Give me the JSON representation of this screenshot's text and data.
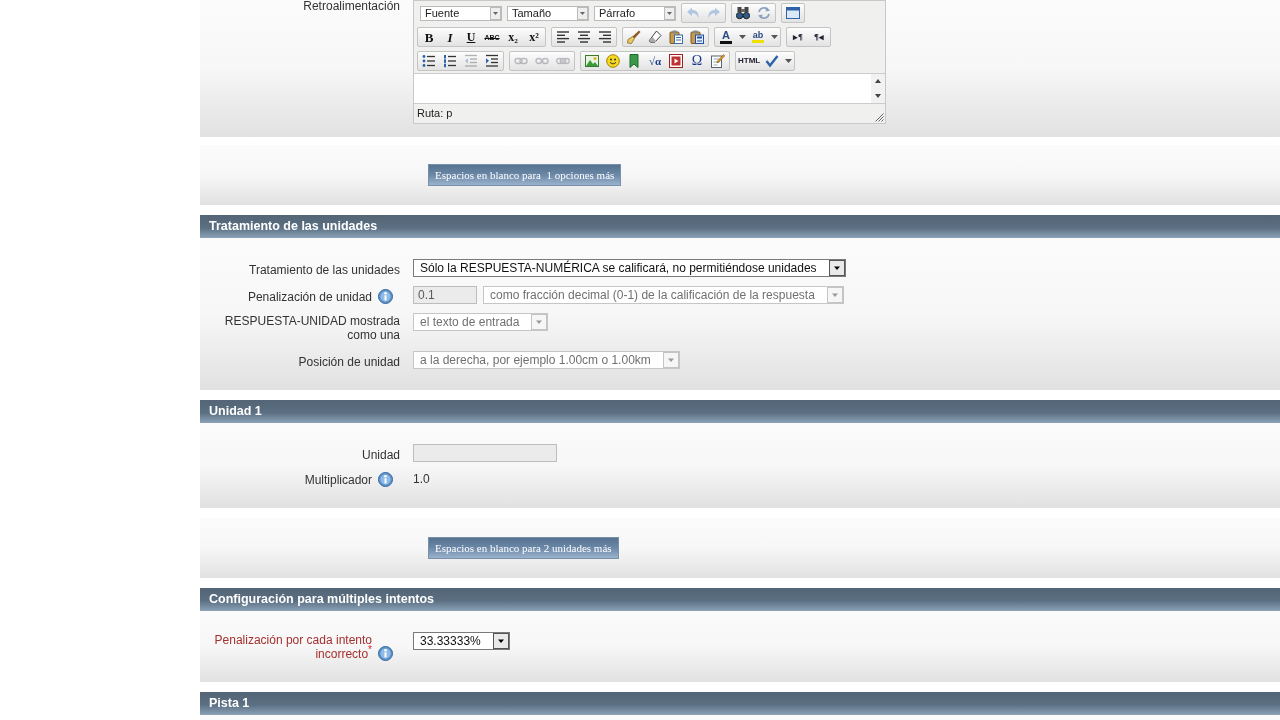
{
  "sections": [
    {
      "kind": "editor",
      "label": "Retroalimentación",
      "toolbar": [
        [
          [
            {
              "kind": "dropdown",
              "value": "Fuente",
              "disabled": false
            },
            {
              "kind": "dropdown",
              "value": "Tamaño",
              "disabled": false
            },
            {
              "kind": "dropdown",
              "value": "Párrafo",
              "disabled": false
            }
          ],
          [
            {
              "kind": "icon",
              "disabled": true
            },
            {
              "kind": "icon",
              "disabled": true
            }
          ],
          [
            {
              "kind": "icon",
              "disabled": false
            },
            {
              "kind": "icon",
              "disabled": false
            }
          ],
          [
            {
              "kind": "icon",
              "disabled": false
            }
          ]
        ],
        [
          [
            {
              "kind": "glyph",
              "glyph": "B",
              "disabled": false
            },
            {
              "kind": "glyph",
              "glyph": "I",
              "disabled": false
            },
            {
              "kind": "glyph",
              "glyph": "U",
              "disabled": false
            },
            {
              "kind": "glyph",
              "glyph": "ABC",
              "disabled": false
            },
            {
              "kind": "glyph",
              "glyph": "x₂",
              "disabled": false
            },
            {
              "kind": "glyph",
              "glyph": "x²",
              "disabled": false
            }
          ],
          [
            {
              "kind": "icon",
              "disabled": false
            },
            {
              "kind": "icon",
              "disabled": false
            },
            {
              "kind": "icon",
              "disabled": false
            }
          ],
          [
            {
              "kind": "icon",
              "disabled": false
            },
            {
              "kind": "icon",
              "disabled": false
            },
            {
              "kind": "icon",
              "disabled": false
            },
            {
              "kind": "icon",
              "disabled": false
            }
          ],
          [
            {
              "kind": "split",
              "glyph": "A",
              "disabled": false
            },
            {
              "kind": "split",
              "glyph": "ab",
              "disabled": false
            }
          ],
          [
            {
              "kind": "glyph",
              "glyph": "▸¶",
              "disabled": false
            },
            {
              "kind": "glyph",
              "glyph": "¶◂",
              "disabled": false
            }
          ]
        ],
        [
          [
            {
              "kind": "icon",
              "disabled": false
            },
            {
              "kind": "icon",
              "disabled": false
            },
            {
              "kind": "icon",
              "disabled": true
            },
            {
              "kind": "icon",
              "disabled": false
            }
          ],
          [
            {
              "kind": "icon",
              "disabled": true
            },
            {
              "kind": "icon",
              "disabled": true
            },
            {
              "kind": "icon",
              "disabled": true
            }
          ],
          [
            {
              "kind": "icon",
              "disabled": false
            },
            {
              "kind": "icon",
              "disabled": false
            },
            {
              "kind": "icon",
              "disabled": false
            },
            {
              "kind": "glyph",
              "glyph": "√α",
              "disabled": false
            },
            {
              "kind": "icon",
              "disabled": false
            },
            {
              "kind": "glyph",
              "glyph": "Ω",
              "disabled": false
            },
            {
              "kind": "icon",
              "disabled": false
            }
          ],
          [
            {
              "kind": "glyph",
              "glyph": "HTML",
              "disabled": false
            },
            {
              "kind": "split_icon",
              "disabled": false
            }
          ]
        ]
      ],
      "path": "Ruta: p"
    },
    {
      "kind": "button_panel",
      "button": "Espacios en blanco para  1 opciones más"
    },
    {
      "kind": "fieldset",
      "title": "Tratamiento de las unidades",
      "fields": [
        {
          "kind": "select",
          "label": "Tratamiento de las unidades",
          "help": false,
          "required": false,
          "value": "Sólo la RESPUESTA-NUMÉRICA se calificará, no permitiéndose unidades",
          "disabled": false
        },
        {
          "kind": "text_select",
          "label": "Penalización de unidad",
          "help": true,
          "required": false,
          "value": "0.1",
          "option": "como fracción decimal (0-1) de la calificación de la respuesta",
          "disabled": true
        },
        {
          "kind": "select",
          "label": "RESPUESTA-UNIDAD mostrada como una",
          "help": false,
          "required": false,
          "value": "el texto de entrada",
          "disabled": true
        },
        {
          "kind": "select",
          "label": "Posición de unidad",
          "help": false,
          "required": false,
          "value": "a la derecha, por ejemplo 1.00cm o 1.00km",
          "disabled": true
        }
      ]
    },
    {
      "kind": "fieldset",
      "title": "Unidad 1",
      "fields": [
        {
          "kind": "text",
          "label": "Unidad",
          "help": false,
          "required": false,
          "disabled": true
        },
        {
          "kind": "static",
          "label": "Multiplicador",
          "help": true,
          "required": false,
          "value": "1.0"
        }
      ]
    },
    {
      "kind": "button_panel",
      "button": "Espacios en blanco para 2 unidades más"
    },
    {
      "kind": "fieldset",
      "title": "Configuración para múltiples intentos",
      "fields": [
        {
          "kind": "select",
          "label": "Penalización por cada intento incorrecto$^{*}$",
          "help": true,
          "required": true,
          "value": "33.33333%",
          "disabled": false
        }
      ]
    },
    {
      "kind": "fieldset",
      "title": "Pista 1"
    }
  ]
}
